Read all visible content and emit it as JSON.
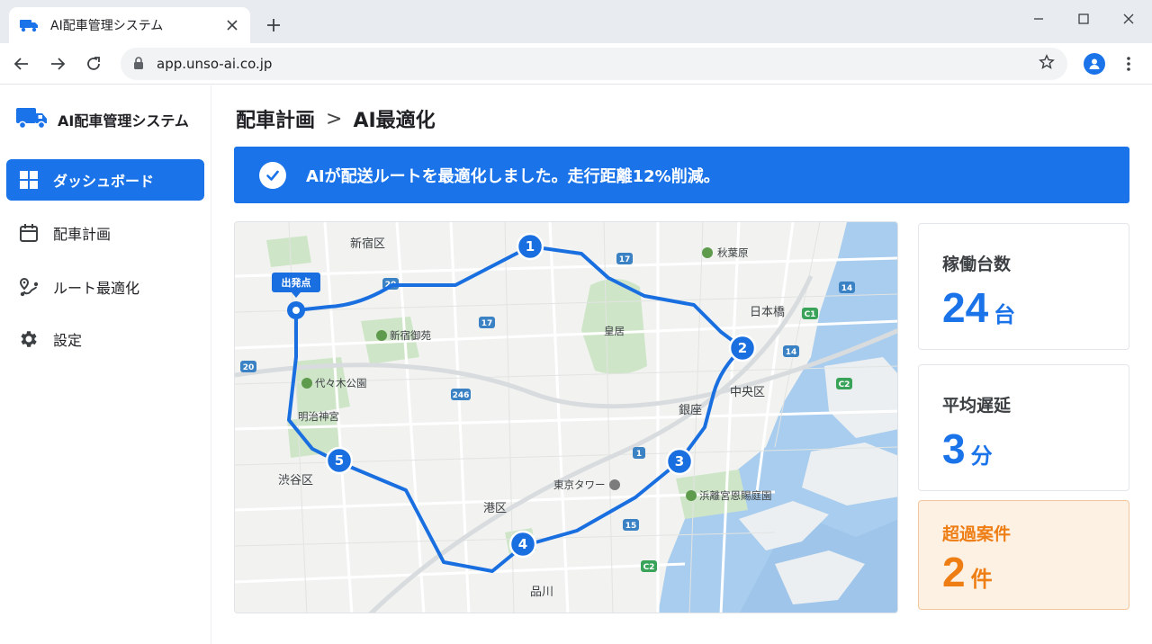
{
  "browser": {
    "tab_title": "AI配車管理システム",
    "url": "app.unso-ai.co.jp"
  },
  "sidebar": {
    "brand": "AI配車管理システム",
    "items": [
      {
        "label": "ダッシュボード",
        "icon": "dashboard-grid-icon",
        "active": true
      },
      {
        "label": "配車計画",
        "icon": "calendar-icon",
        "active": false
      },
      {
        "label": "ルート最適化",
        "icon": "route-icon",
        "active": false
      },
      {
        "label": "設定",
        "icon": "gear-icon",
        "active": false
      }
    ]
  },
  "main": {
    "breadcrumb": [
      "配車計画",
      "AI最適化"
    ],
    "breadcrumb_sep": ">",
    "banner": "AIが配送ルートを最適化しました。走行距離12%削減。"
  },
  "map": {
    "start_label": "出発点",
    "stops": [
      "1",
      "2",
      "3",
      "4",
      "5"
    ],
    "districts": [
      "新宿区",
      "渋谷区",
      "港区",
      "中央区",
      "品川",
      "銀座",
      "日本橋"
    ],
    "landmarks": [
      "秋葉原",
      "皇居",
      "新宿御苑",
      "代々木公園",
      "明治神宮",
      "東京タワー",
      "浜離宮恩賜庭園"
    ],
    "road_shields": [
      "20",
      "17",
      "17",
      "20",
      "246",
      "1",
      "15",
      "14",
      "14",
      "C1",
      "C2",
      "C2"
    ]
  },
  "stats": [
    {
      "label": "稼働台数",
      "value": "24",
      "unit": "台",
      "highlight": false
    },
    {
      "label": "平均遅延",
      "value": "3",
      "unit": "分",
      "highlight": false
    },
    {
      "label": "超過案件",
      "value": "2",
      "unit": "件",
      "highlight": true
    }
  ],
  "colors": {
    "primary": "#1a73e8",
    "warning": "#ee7d14",
    "warning_bg": "#fdf1e4"
  }
}
